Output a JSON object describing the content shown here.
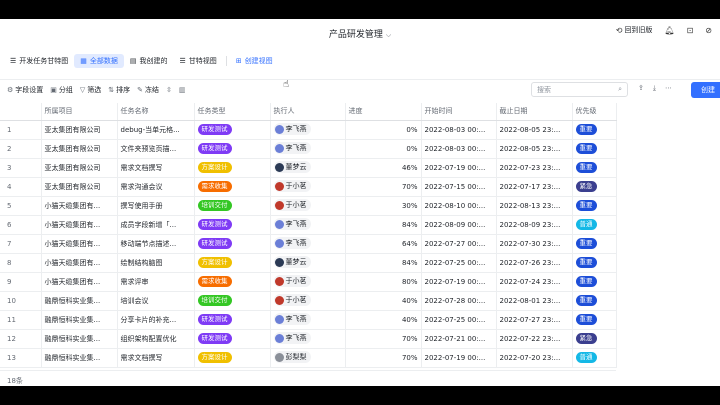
{
  "header": {
    "title": "产品研发管理",
    "back_label": "回到旧版"
  },
  "tabs": [
    {
      "label": "开发任务甘特图",
      "icon": "gantt-icon",
      "active": false
    },
    {
      "label": "全部数据",
      "icon": "grid-icon",
      "active": true
    },
    {
      "label": "我创建的",
      "icon": "table-icon",
      "active": false
    },
    {
      "label": "甘特视图",
      "icon": "gantt-icon",
      "active": false
    }
  ],
  "create_view_label": "创建视图",
  "toolbar": {
    "field_settings": "字段设置",
    "group": "分组",
    "filter": "筛选",
    "sort": "排序",
    "freeze": "冻结",
    "search_placeholder": "搜索",
    "create_label": "创建"
  },
  "columns": [
    "所属项目",
    "任务名称",
    "任务类型",
    "执行人",
    "进度",
    "开始时间",
    "截止日期",
    "优先级"
  ],
  "colors": {
    "研发测试": "#7f3bf5",
    "方案设计": "#f0c000",
    "需求收集": "#f76d00",
    "培训交付": "#34c724",
    "重要": "#1d4ed8",
    "紧急": "#3b3f8f",
    "普通": "#14b8e6",
    "accent": "#3370ff"
  },
  "avatars": {
    "李飞燕": "#6b7fd7",
    "董梦云": "#2b3a55",
    "于小茗": "#c0392b",
    "彭梨梨": "#8a8f98"
  },
  "rows": [
    {
      "num": "1",
      "project": "亚太集团有限公司",
      "task": "debug-当单元格...",
      "type": "研发测试",
      "person": "李飞燕",
      "progress": "0%",
      "start": "2022-08-03 00:...",
      "end": "2022-08-05 23:...",
      "priority": "重要"
    },
    {
      "num": "2",
      "project": "亚太集团有限公司",
      "task": "文件夹预览页描...",
      "type": "研发测试",
      "person": "李飞燕",
      "progress": "0%",
      "start": "2022-08-03 00:...",
      "end": "2022-08-05 23:...",
      "priority": "重要"
    },
    {
      "num": "3",
      "project": "亚太集团有限公司",
      "task": "需求文档撰写",
      "type": "方案设计",
      "person": "董梦云",
      "progress": "46%",
      "start": "2022-07-19 00:...",
      "end": "2022-07-23 23:...",
      "priority": "重要"
    },
    {
      "num": "4",
      "project": "亚太集团有限公司",
      "task": "需求沟通会议",
      "type": "需求收集",
      "person": "于小茗",
      "progress": "70%",
      "start": "2022-07-15 00:...",
      "end": "2022-07-17 23:...",
      "priority": "紧急"
    },
    {
      "num": "5",
      "project": "小猫天缆集团有...",
      "task": "撰写使用手册",
      "type": "培训交付",
      "person": "于小茗",
      "progress": "30%",
      "start": "2022-08-10 00:...",
      "end": "2022-08-13 23:...",
      "priority": "重要"
    },
    {
      "num": "6",
      "project": "小猫天缆集团有...",
      "task": "成员字段新增「...",
      "type": "研发测试",
      "person": "李飞燕",
      "progress": "84%",
      "start": "2022-08-09 00:...",
      "end": "2022-08-09 23:...",
      "priority": "普通"
    },
    {
      "num": "7",
      "project": "小猫天缆集团有...",
      "task": "移动端节点描述...",
      "type": "研发测试",
      "person": "李飞燕",
      "progress": "64%",
      "start": "2022-07-27 00:...",
      "end": "2022-07-30 23:...",
      "priority": "重要"
    },
    {
      "num": "8",
      "project": "小猫天缆集团有...",
      "task": "绘制结构脑图",
      "type": "方案设计",
      "person": "董梦云",
      "progress": "84%",
      "start": "2022-07-25 00:...",
      "end": "2022-07-26 23:...",
      "priority": "重要"
    },
    {
      "num": "9",
      "project": "小猫天缆集团有...",
      "task": "需求评审",
      "type": "需求收集",
      "person": "于小茗",
      "progress": "80%",
      "start": "2022-07-19 00:...",
      "end": "2022-07-24 23:...",
      "priority": "重要"
    },
    {
      "num": "10",
      "project": "融鼎恒科实业集...",
      "task": "培训会议",
      "type": "培训交付",
      "person": "于小茗",
      "progress": "40%",
      "start": "2022-07-28 00:...",
      "end": "2022-08-01 23:...",
      "priority": "重要"
    },
    {
      "num": "11",
      "project": "融鼎恒科实业集...",
      "task": "分享卡片的补充...",
      "type": "研发测试",
      "person": "李飞燕",
      "progress": "40%",
      "start": "2022-07-25 00:...",
      "end": "2022-07-27 23:...",
      "priority": "重要"
    },
    {
      "num": "12",
      "project": "融鼎恒科实业集...",
      "task": "组织架构配置优化",
      "type": "研发测试",
      "person": "李飞燕",
      "progress": "70%",
      "start": "2022-07-21 00:...",
      "end": "2022-07-22 23:...",
      "priority": "紧急"
    },
    {
      "num": "13",
      "project": "融鼎恒科实业集...",
      "task": "需求文档撰写",
      "type": "方案设计",
      "person": "彭梨梨",
      "progress": "70%",
      "start": "2022-07-19 00:...",
      "end": "2022-07-20 23:...",
      "priority": "普通"
    }
  ],
  "footer": {
    "count_label": "18条"
  }
}
